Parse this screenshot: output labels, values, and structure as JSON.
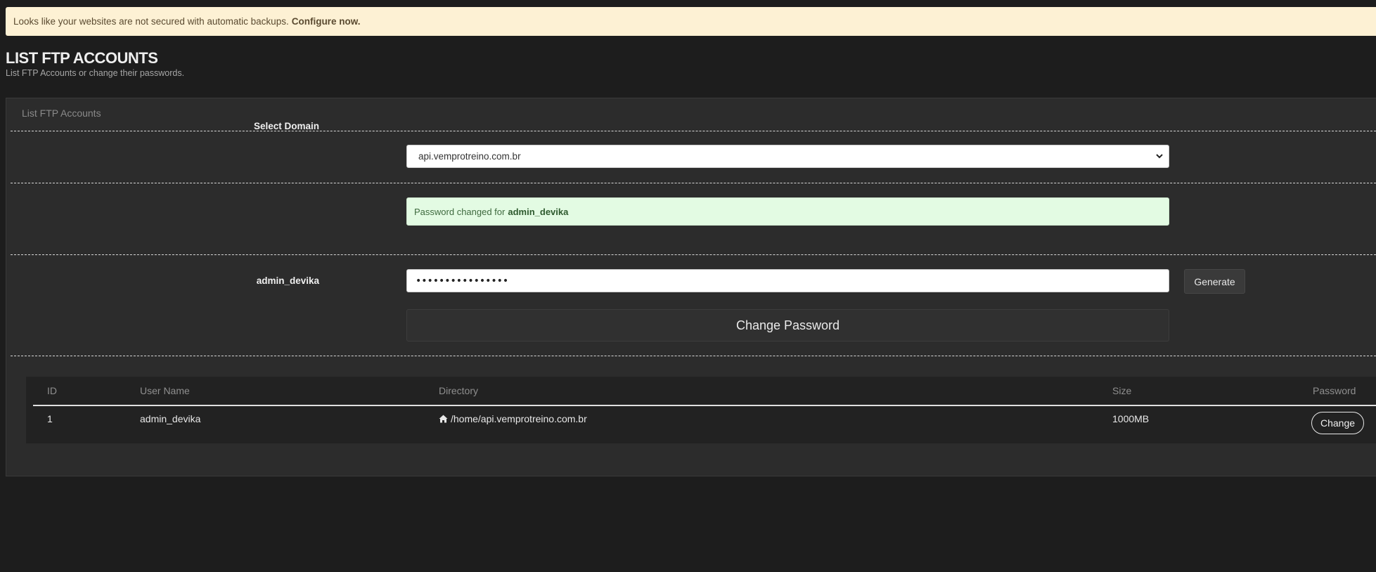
{
  "alert": {
    "message": "Looks like your websites are not secured with automatic backups.",
    "link": "Configure now."
  },
  "page": {
    "title": "LIST FTP ACCOUNTS",
    "subtitle": "List FTP Accounts or change their passwords."
  },
  "panel": {
    "heading": "List FTP Accounts"
  },
  "domain": {
    "label": "Select Domain",
    "value": "api.vemprotreino.com.br"
  },
  "success": {
    "prefix": "Password changed for",
    "user": "admin_devika"
  },
  "password": {
    "label": "admin_devika",
    "value": "••••••••••••••••",
    "generate_label": "Generate",
    "change_label": "Change Password"
  },
  "table": {
    "headers": [
      "ID",
      "User Name",
      "Directory",
      "Size",
      "Password"
    ],
    "rows": [
      {
        "id": "1",
        "user": "admin_devika",
        "directory": "/home/api.vemprotreino.com.br",
        "size": "1000MB",
        "action": "Change"
      }
    ]
  },
  "icons": {
    "directory": "home-icon",
    "select": "chevron-down-icon"
  },
  "colors": {
    "background": "#1d1d1d",
    "alert_bg": "#fdf1d4",
    "success_bg": "#e3fbe3",
    "panel_bg": "#2c2c2c"
  }
}
